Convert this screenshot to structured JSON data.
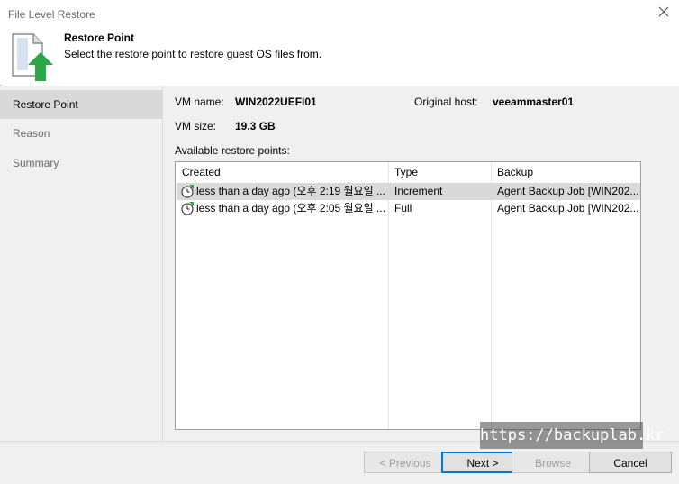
{
  "window": {
    "title": "File Level Restore"
  },
  "header": {
    "title": "Restore Point",
    "description": "Select the restore point to restore guest OS files from."
  },
  "nav": {
    "items": [
      {
        "label": "Restore Point",
        "active": true
      },
      {
        "label": "Reason",
        "active": false
      },
      {
        "label": "Summary",
        "active": false
      }
    ]
  },
  "vm": {
    "name_label": "VM name:",
    "name_value": "WIN2022UEFI01",
    "host_label": "Original host:",
    "host_value": "veeammaster01",
    "size_label": "VM size:",
    "size_value": "19.3 GB"
  },
  "restore_points": {
    "label": "Available restore points:",
    "columns": [
      "Created",
      "Type",
      "Backup"
    ],
    "rows": [
      {
        "created": "less than a day ago (오후 2:19 월요일 ...",
        "type": "Increment",
        "backup": "Agent Backup Job [WIN202...",
        "selected": true
      },
      {
        "created": "less than a day ago (오후 2:05 월요일 ...",
        "type": "Full",
        "backup": "Agent Backup Job [WIN202...",
        "selected": false
      }
    ]
  },
  "watermark": "https://backuplab.kr",
  "buttons": {
    "previous": "< Previous",
    "next": "Next >",
    "browse": "Browse",
    "cancel": "Cancel"
  },
  "colors": {
    "accent": "#0078d7",
    "selection": "#d9d9d9",
    "panel": "#f0f0f0",
    "icon_green": "#2aa845"
  }
}
